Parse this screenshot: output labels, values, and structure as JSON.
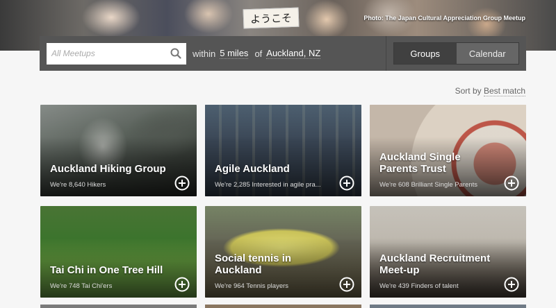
{
  "hero": {
    "sign_text": "ようこそ",
    "photo_credit": "Photo: The Japan Cultural Appreciation Group Meetup"
  },
  "search": {
    "placeholder": "All Meetups",
    "within_label": "within",
    "distance": "5 miles",
    "of_label": "of",
    "location": "Auckland, NZ"
  },
  "view_toggle": {
    "groups_label": "Groups",
    "calendar_label": "Calendar",
    "active": "Groups"
  },
  "sort": {
    "label": "Sort by",
    "value": "Best match"
  },
  "groups": [
    {
      "name": "Auckland Hiking Group",
      "members": "We're 8,640 Hikers"
    },
    {
      "name": "Agile Auckland",
      "members": "We're 2,285 Interested in agile pra..."
    },
    {
      "name": "Auckland Single Parents Trust",
      "members": "We're 608 Brilliant Single Parents"
    },
    {
      "name": "Tai Chi in One Tree Hill",
      "members": "We're 748 Tai Chi'ers"
    },
    {
      "name": "Social tennis in Auckland",
      "members": "We're 964 Tennis players"
    },
    {
      "name": "Auckland Recruitment Meet-up",
      "members": "We're 439 Finders of talent"
    }
  ],
  "colors": {
    "search_bar_bg": "#555555",
    "toggle_active_bg": "#404040",
    "page_bg": "#f6f6f6"
  }
}
